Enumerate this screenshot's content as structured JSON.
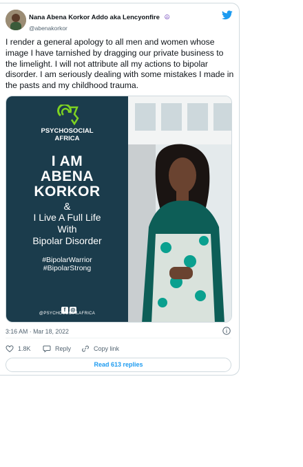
{
  "author": {
    "display_name": "Nana Abena Korkor Addo aka Lencyonfire",
    "emoji": "☮",
    "handle": "@abenakorkor"
  },
  "tweet": {
    "text": "I render a general apology to all men and women whose image I have tarnished by dragging our private business to the limelight. I will not attribute all my actions to bipolar disorder. I am seriously dealing with some mistakes I made in the pasts and my childhood trauma.",
    "timestamp": "3:16 AM · Mar 18, 2022"
  },
  "media": {
    "org_line1": "PSYCHOSOCIAL",
    "org_line2": "AFRICA",
    "headline_1": "I AM",
    "headline_2": "ABENA",
    "headline_3": "KORKOR",
    "ampersand": "&",
    "sub_1": "I Live A Full Life",
    "sub_2": "With",
    "sub_3": "Bipolar Disorder",
    "tag_1": "#BipolarWarrior",
    "tag_2": "#BipolarStrong",
    "social_handle": "@PSYCHOSOCIALAFRICA",
    "brand_color": "#1b3c4c",
    "accent_color": "#7ed321"
  },
  "actions": {
    "likes": "1.8K",
    "reply_label": "Reply",
    "copy_label": "Copy link",
    "read_replies": "Read 613 replies"
  },
  "colors": {
    "link_blue": "#1d9bf0",
    "muted": "#536471"
  }
}
